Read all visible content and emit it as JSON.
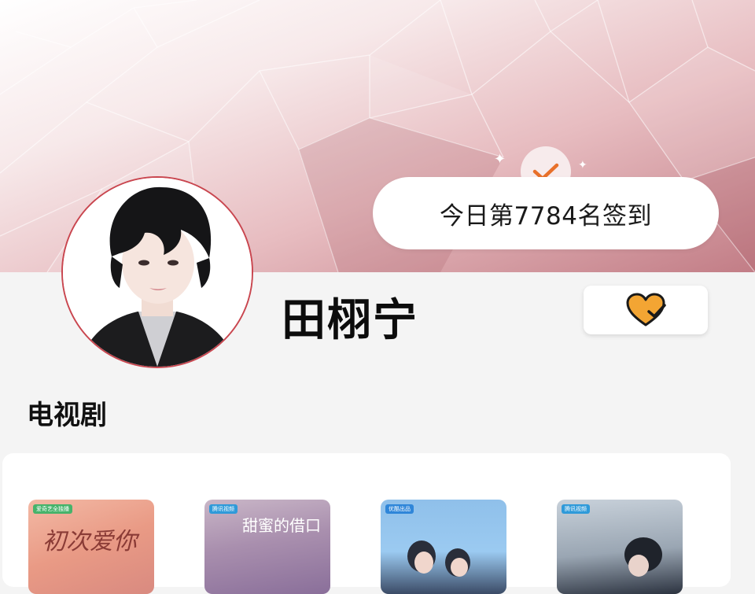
{
  "checkin": {
    "text": "今日第7784名签到",
    "icon": "checkmark-icon"
  },
  "profile": {
    "name": "田栩宁",
    "avatar_icon": "avatar-photo",
    "fan_button_icon": "heart-check-icon"
  },
  "section": {
    "title": "电视剧"
  },
  "tv_series": [
    {
      "tag": "爱奇艺全独播",
      "title": "初次爱你",
      "tag_color": "#46b36b"
    },
    {
      "tag": "腾讯视频",
      "title": "甜蜜的借口",
      "tag_color": "#2f9ad9"
    },
    {
      "tag": "优酷出品",
      "title": "",
      "tag_color": "#2f86d9"
    },
    {
      "tag": "腾讯视频",
      "title": "",
      "tag_color": "#2f9ad9"
    }
  ],
  "colors": {
    "accent": "#e8702a",
    "heart": "#f3a533",
    "avatar_ring": "#c9464f",
    "banner_dark": "#c27d86"
  }
}
